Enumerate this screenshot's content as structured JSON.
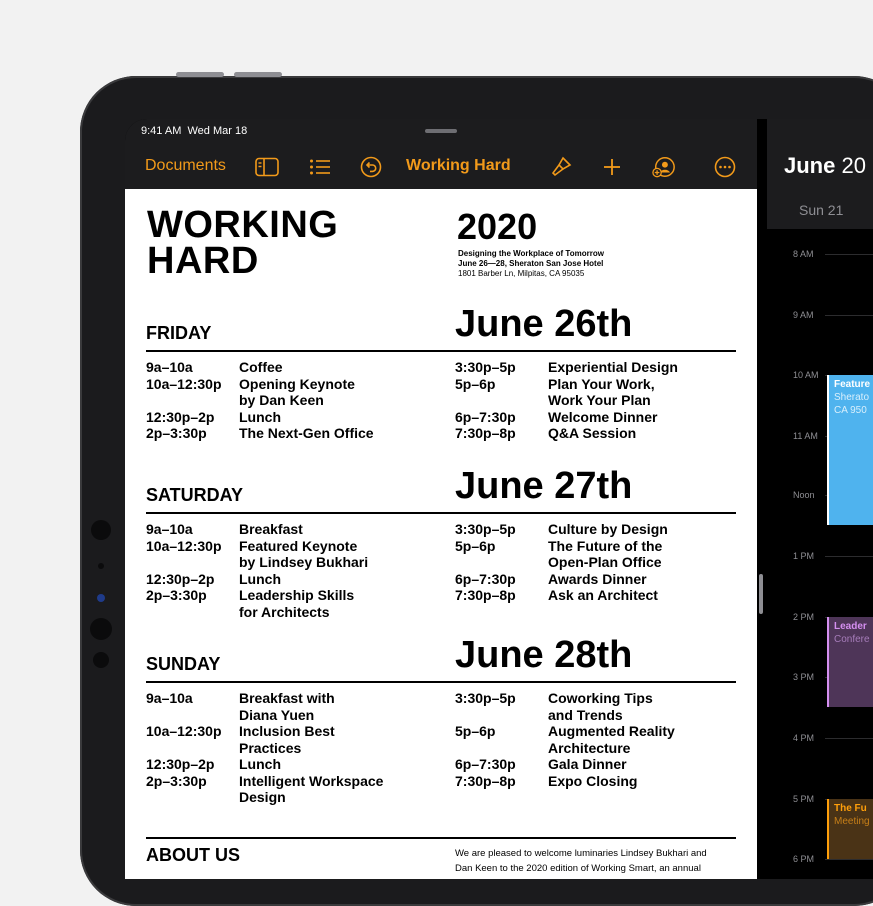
{
  "status": {
    "time": "9:41 AM",
    "date": "Wed Mar 18"
  },
  "toolbar": {
    "documents_label": "Documents",
    "doc_title": "Working Hard",
    "icons": [
      "sidebar-icon",
      "list-icon",
      "undo-icon",
      "format-brush-icon",
      "plus-icon",
      "collaborate-icon",
      "more-icon"
    ]
  },
  "document": {
    "title_line1": "WORKING",
    "title_line2": "HARD",
    "year": "2020",
    "subtitle_line1": "Designing the Workplace of Tomorrow",
    "subtitle_line2": "June 26—28, Sheraton San Jose Hotel",
    "address": "1801 Barber Ln, Milpitas, CA 95035",
    "days": [
      {
        "day": "FRIDAY",
        "date": "June 26th",
        "left": [
          {
            "time": "9a–10a",
            "event": "Coffee"
          },
          {
            "time": "10a–12:30p",
            "event": "Opening Keynote"
          },
          {
            "time": "",
            "event": "by Dan Keen"
          },
          {
            "time": "12:30p–2p",
            "event": "Lunch"
          },
          {
            "time": "2p–3:30p",
            "event": "The Next-Gen Office"
          }
        ],
        "right": [
          {
            "time": "3:30p–5p",
            "event": "Experiential Design"
          },
          {
            "time": "5p–6p",
            "event": "Plan Your Work,"
          },
          {
            "time": "",
            "event": "Work Your Plan"
          },
          {
            "time": "6p–7:30p",
            "event": "Welcome Dinner"
          },
          {
            "time": "7:30p–8p",
            "event": "Q&A Session"
          }
        ]
      },
      {
        "day": "SATURDAY",
        "date": "June 27th",
        "left": [
          {
            "time": "9a–10a",
            "event": "Breakfast"
          },
          {
            "time": "10a–12:30p",
            "event": "Featured Keynote"
          },
          {
            "time": "",
            "event": "by Lindsey Bukhari"
          },
          {
            "time": "12:30p–2p",
            "event": "Lunch"
          },
          {
            "time": "2p–3:30p",
            "event": "Leadership Skills"
          },
          {
            "time": "",
            "event": "for Architects"
          }
        ],
        "right": [
          {
            "time": "3:30p–5p",
            "event": "Culture by Design"
          },
          {
            "time": "5p–6p",
            "event": "The Future of the"
          },
          {
            "time": "",
            "event": "Open-Plan Office"
          },
          {
            "time": "6p–7:30p",
            "event": "Awards Dinner"
          },
          {
            "time": "7:30p–8p",
            "event": "Ask an Architect"
          }
        ]
      },
      {
        "day": "SUNDAY",
        "date": "June 28th",
        "left": [
          {
            "time": "9a–10a",
            "event": "Breakfast with"
          },
          {
            "time": "",
            "event": "Diana Yuen"
          },
          {
            "time": "10a–12:30p",
            "event": "Inclusion Best"
          },
          {
            "time": "",
            "event": "Practices"
          },
          {
            "time": "12:30p–2p",
            "event": "Lunch"
          },
          {
            "time": "2p–3:30p",
            "event": "Intelligent Workspace"
          },
          {
            "time": "",
            "event": "Design"
          }
        ],
        "right": [
          {
            "time": "3:30p–5p",
            "event": "Coworking Tips"
          },
          {
            "time": "",
            "event": "and Trends"
          },
          {
            "time": "5p–6p",
            "event": "Augmented Reality"
          },
          {
            "time": "",
            "event": "Architecture"
          },
          {
            "time": "6p–7:30p",
            "event": "Gala Dinner"
          },
          {
            "time": "7:30p–8p",
            "event": "Expo Closing"
          }
        ]
      }
    ],
    "about_heading": "ABOUT US",
    "about_line1": "We are pleased to welcome luminaries Lindsey Bukhari and",
    "about_line2": "Dan Keen to the 2020 edition of Working Smart, an annual"
  },
  "calendar": {
    "month": "June",
    "year_partial": "20",
    "day_label": "Sun 21",
    "hours": [
      "8 AM",
      "9 AM",
      "10 AM",
      "11 AM",
      "Noon",
      "1 PM",
      "2 PM",
      "3 PM",
      "4 PM",
      "5 PM",
      "6 PM"
    ],
    "events": [
      {
        "title": "Feature",
        "line2": "Sherato",
        "line3": "CA  950",
        "color": "#4fb3ee",
        "text": "#ffffff",
        "sub": "#d8effc"
      },
      {
        "title": "Leader",
        "line2": "Confere",
        "line3": "",
        "color": "#4e3558",
        "text": "#d48ff0",
        "sub": "#a67cba"
      },
      {
        "title": "The Fu",
        "line2": "Meeting",
        "line3": "",
        "color": "#4a3316",
        "text": "#ff9f0a",
        "sub": "#c77f18"
      }
    ]
  }
}
